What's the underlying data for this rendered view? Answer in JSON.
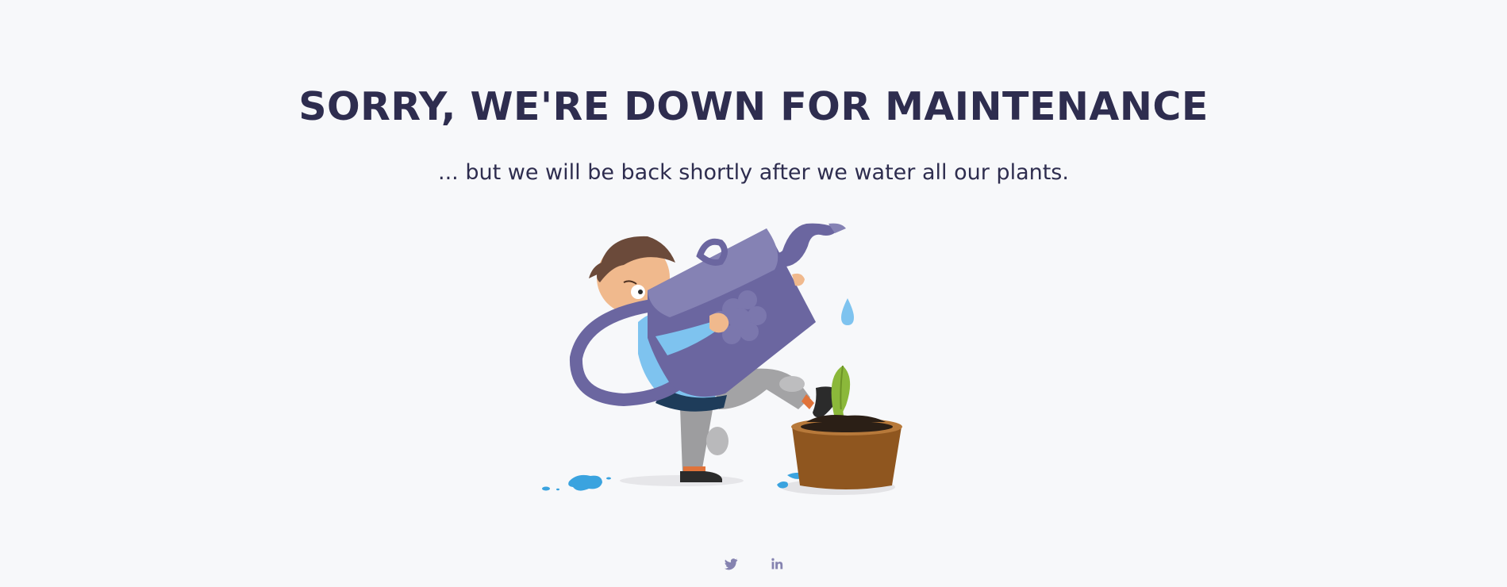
{
  "page": {
    "headline": "SORRY, WE'RE DOWN FOR MAINTENANCE",
    "subline": "... but we will be back shortly after we water all our plants."
  },
  "illustration": {
    "subject": "person-with-watering-can-and-potted-plant"
  },
  "social": {
    "items": [
      {
        "icon": "twitter-icon"
      },
      {
        "icon": "linkedin-icon"
      }
    ]
  },
  "colors": {
    "background": "#f7f8fa",
    "text": "#2e2d4f",
    "can": "#6b66a0",
    "can_light": "#8582b4",
    "water": "#3aa3df",
    "pot": "#8f561f",
    "leaf": "#8bb83a",
    "social_icon": "#8583b0"
  }
}
